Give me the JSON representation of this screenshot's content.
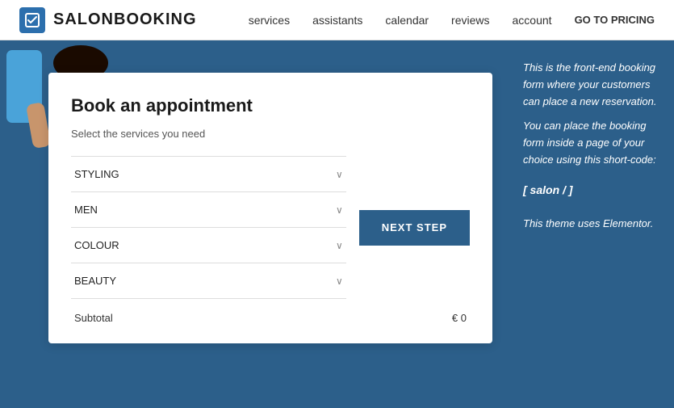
{
  "header": {
    "logo_text": "SALONBOOKING",
    "nav": {
      "services": "services",
      "assistants": "assistants",
      "calendar": "calendar",
      "reviews": "reviews",
      "account": "account",
      "pricing": "GO TO PRICING"
    }
  },
  "booking": {
    "title": "Book an appointment",
    "subtitle": "Select the services you need",
    "services": [
      {
        "id": "styling",
        "label": "STYLING"
      },
      {
        "id": "men",
        "label": "MEN"
      },
      {
        "id": "colour",
        "label": "COLOUR"
      },
      {
        "id": "beauty",
        "label": "BEAUTY"
      }
    ],
    "next_step_label": "NEXT STEP",
    "subtotal_label": "Subtotal",
    "subtotal_value": "€ 0"
  },
  "sidebar": {
    "paragraph1": "This is the front-end booking form where your customers can place a new reservation.",
    "paragraph2": "You can place the booking form inside a page of your choice using this short-code:",
    "shortcode": "[ salon / ]",
    "theme_note": "This theme uses Elementor."
  }
}
